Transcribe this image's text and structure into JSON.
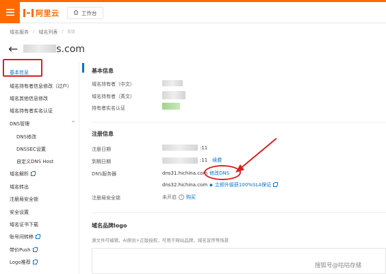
{
  "topbar": {
    "brand_text": "阿里云",
    "workbench_label": "工作台",
    "brand_color": "#ff6a00"
  },
  "breadcrumb": [
    "域名服务",
    "域名列表",
    ""
  ],
  "page": {
    "title_suffix": "s.com"
  },
  "sidebar": {
    "items": [
      {
        "label": "基本信息",
        "active": true
      },
      {
        "label": "域名持有者信息修改（过户）"
      },
      {
        "label": "域名其他信息修改"
      },
      {
        "label": "域名持有者实名认证"
      },
      {
        "label": "DNS管理"
      },
      {
        "label": "DNS修改"
      },
      {
        "label": "DNSSEC设置"
      },
      {
        "label": "自定义DNS Host"
      },
      {
        "label": "域名解析"
      },
      {
        "label": "域名转出"
      },
      {
        "label": "注册局安全锁"
      },
      {
        "label": "安全设置"
      },
      {
        "label": "域名证书下载"
      },
      {
        "label": "账号间转移"
      },
      {
        "label": "带价Push"
      },
      {
        "label": "Logo推荐"
      }
    ],
    "collapse_caret": "^",
    "active_color": "#0070cc"
  },
  "basic_info": {
    "title": "基本信息",
    "rows": [
      {
        "label": "域名持有者（中文）"
      },
      {
        "label": "域名持有者（英文）"
      },
      {
        "label": "持有者实名认证"
      }
    ]
  },
  "registration_info": {
    "title": "注册信息",
    "registration_date_label": "注册日期",
    "registration_date_value": ":11",
    "expiry_date_label": "到期日期",
    "expiry_date_value": ":11",
    "renew_label": "续费",
    "dns_label": "DNS服务器",
    "dns1": "dns31.hichina.com",
    "modify_dns_label": "修改DNS",
    "dns2": "dns32.hichina.com",
    "upgrade_label": "立即升级获100%SLA保证",
    "lock_label": "注册局安全锁",
    "lock_status": "未开启",
    "buy_label": "购买"
  },
  "logo_section": {
    "title": "域名品牌logo",
    "description": "源文件可编辑，AI原创+正版授权，可用于网站品牌，域名宣传等场景"
  },
  "watermark": "搜狐号@咕咕存储",
  "annotation_color": "#d9201f"
}
